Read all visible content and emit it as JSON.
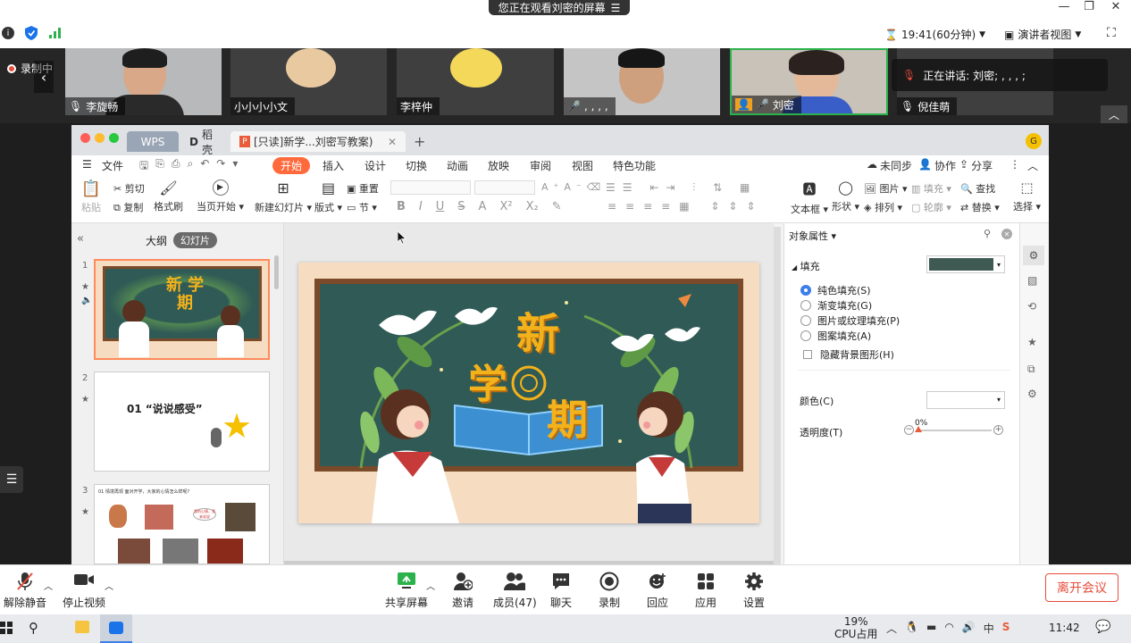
{
  "top": {
    "share_banner": "您正在观看刘密的屏幕",
    "time": "19:41(60分钟)",
    "view_mode": "演讲者视图"
  },
  "strip": {
    "recording": "录制中",
    "speaking": "正在讲话: 刘密; , , , ;",
    "participants": [
      {
        "name": "李旋畅"
      },
      {
        "name": "小小小小文"
      },
      {
        "name": "李梓仲"
      },
      {
        "name": ", , , ,"
      },
      {
        "name": "刘密"
      },
      {
        "name": "倪佳萌"
      }
    ]
  },
  "wps": {
    "tabs": [
      "WPS",
      "稻壳",
      "[只读]新学...刘密写教案)"
    ],
    "menu": [
      "文件",
      "开始",
      "插入",
      "设计",
      "切换",
      "动画",
      "放映",
      "审阅",
      "视图",
      "特色功能"
    ],
    "menu_right": [
      "未同步",
      "协作",
      "分享"
    ],
    "ribbon": {
      "paste": "粘贴",
      "cut": "剪切",
      "copy": "复制",
      "format_painter": "格式刷",
      "from_current": "当页开始",
      "new_slide": "新建幻灯片",
      "layout": "版式",
      "reset": "重置",
      "section": "节",
      "textbox": "文本框",
      "shape": "形状",
      "picture": "图片",
      "fill": "填充",
      "arrange": "排列",
      "outline": "轮廓",
      "find": "查找",
      "replace": "替换",
      "select": "选择"
    },
    "left_tabs": [
      "大纲",
      "幻灯片"
    ],
    "slides": [
      {
        "num": "1",
        "title": "新 学 期"
      },
      {
        "num": "2",
        "title": "01 “说说感受”"
      },
      {
        "num": "3",
        "title": "01 情境再现 面对开学，大家的心情怎么样呢?",
        "bubble": "我的心情，我来说说"
      }
    ],
    "main_slide": {
      "chars": [
        "新",
        "学",
        "期"
      ]
    },
    "props": {
      "title": "对象属性",
      "section": "填充",
      "fill_color": "#3f5a53",
      "options": [
        "纯色填充(S)",
        "渐变填充(G)",
        "图片或纹理填充(P)",
        "图案填充(A)"
      ],
      "hide_bg": "隐藏背景图形(H)",
      "color_label": "颜色(C)",
      "transparency_label": "透明度(T)",
      "transparency_value": "0%"
    }
  },
  "bottom": {
    "mute": "解除静音",
    "video": "停止视频",
    "buttons": [
      "共享屏幕",
      "邀请",
      "成员(47)",
      "聊天",
      "录制",
      "回应",
      "应用",
      "设置"
    ],
    "leave": "离开会议"
  },
  "taskbar": {
    "cpu_percent": "19%",
    "cpu_label": "CPU占用",
    "clock": "11:42"
  },
  "colors": {
    "accent": "#e85c3a",
    "tab_active": "#ff6a3d",
    "record_red": "#e74c3c"
  }
}
